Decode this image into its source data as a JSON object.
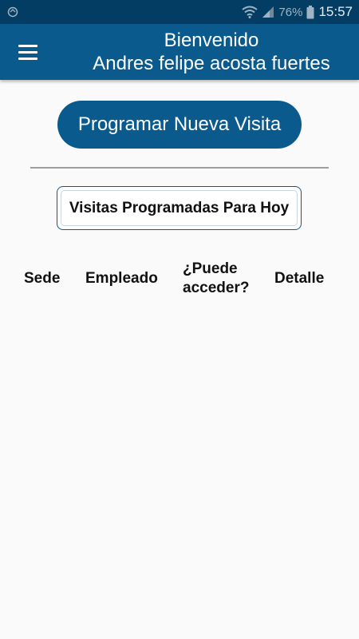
{
  "status_bar": {
    "left_icon": "sync-icon",
    "wifi_icon": "wifi-icon",
    "signal_icon": "signal-icon",
    "battery_percent": "76%",
    "battery_icon": "battery-icon",
    "time": "15:57"
  },
  "header": {
    "menu_icon": "hamburger-menu-icon",
    "welcome": "Bienvenido",
    "user_name": "Andres felipe acosta fuertes"
  },
  "actions": {
    "new_visit_label": "Programar Nueva Visita",
    "today_visits_label": "Visitas Programadas Para Hoy"
  },
  "table": {
    "columns": [
      "Sede",
      "Empleado",
      "¿Puede acceder?",
      "Detalle"
    ],
    "rows": []
  },
  "colors": {
    "status_bar": "#043d63",
    "primary": "#0b5a8e",
    "background": "#fafafa"
  }
}
